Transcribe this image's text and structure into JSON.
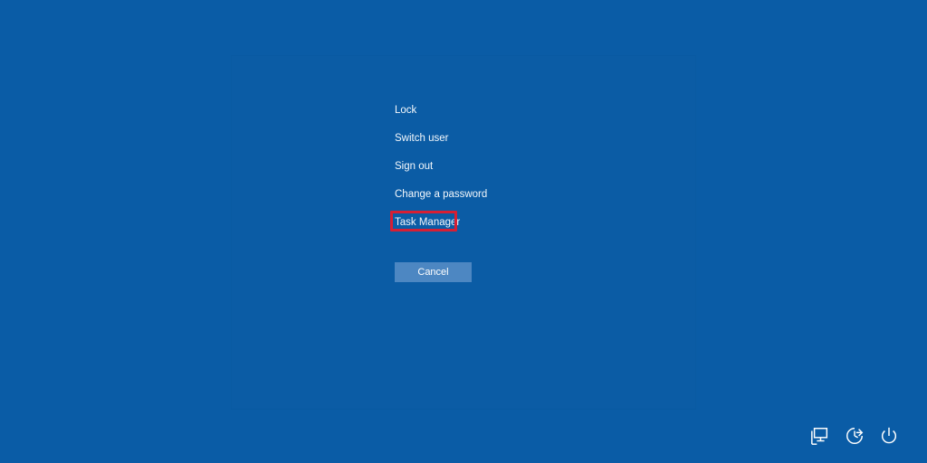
{
  "menu": {
    "items": [
      {
        "label": "Lock"
      },
      {
        "label": "Switch user"
      },
      {
        "label": "Sign out"
      },
      {
        "label": "Change a password"
      },
      {
        "label": "Task Manager"
      }
    ]
  },
  "cancel_label": "Cancel",
  "tray": {
    "icons": [
      "network-icon",
      "ease-of-access-icon",
      "power-icon"
    ]
  },
  "colors": {
    "background": "#0a5ca6",
    "button": "#4d87c2",
    "highlight": "#d61f34",
    "text": "#ffffff"
  }
}
